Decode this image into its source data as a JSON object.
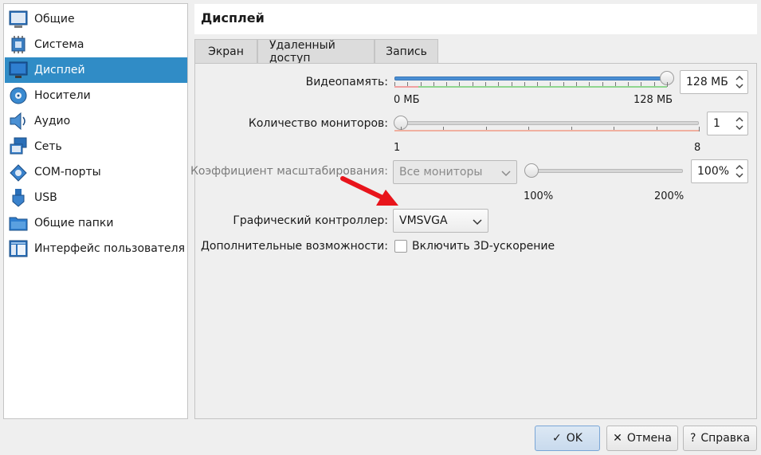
{
  "sidebar": {
    "items": [
      {
        "label": "Общие",
        "icon": "general-icon"
      },
      {
        "label": "Система",
        "icon": "system-chip-icon"
      },
      {
        "label": "Дисплей",
        "icon": "display-monitor-icon",
        "selected": true
      },
      {
        "label": "Носители",
        "icon": "storage-disk-icon"
      },
      {
        "label": "Аудио",
        "icon": "audio-speaker-icon"
      },
      {
        "label": "Сеть",
        "icon": "network-icon"
      },
      {
        "label": "COM-порты",
        "icon": "serial-port-icon"
      },
      {
        "label": "USB",
        "icon": "usb-icon"
      },
      {
        "label": "Общие папки",
        "icon": "shared-folder-icon"
      },
      {
        "label": "Интерфейс пользователя",
        "icon": "user-interface-icon"
      }
    ]
  },
  "header": {
    "title": "Дисплей"
  },
  "tabs": [
    {
      "label": "Экран",
      "active": true
    },
    {
      "label": "Удаленный доступ"
    },
    {
      "label": "Запись"
    }
  ],
  "screen": {
    "video_memory": {
      "label": "Видеопамять:",
      "value_text": "128 МБ",
      "min_label": "0 МБ",
      "max_label": "128 МБ",
      "value_fraction": 1.0
    },
    "monitors": {
      "label": "Количество мониторов:",
      "value_text": "1",
      "min_label": "1",
      "max_label": "8",
      "value_fraction": 0.0
    },
    "scale": {
      "label": "Коэффициент масштабирования:",
      "combo_value": "Все мониторы",
      "value_text": "100%",
      "min_label": "100%",
      "max_label": "200%",
      "value_fraction": 0.0
    },
    "graphics_controller": {
      "label": "Графический контроллер:",
      "value": "VMSVGA"
    },
    "extended_features": {
      "label": "Дополнительные возможности:",
      "checkbox_label": "Включить 3D-ускорение",
      "checked": false
    }
  },
  "buttons": {
    "ok": "OK",
    "cancel": "Отмена",
    "help": "Справка"
  },
  "colors": {
    "accent": "#308cc6",
    "annotation_arrow": "#e8141b"
  }
}
